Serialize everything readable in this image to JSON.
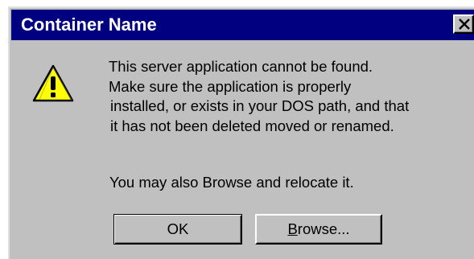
{
  "dialog": {
    "title": "Container Name",
    "close_icon": "close-x-icon",
    "icon": "warning-icon",
    "colors": {
      "titlebar": "#000080",
      "face": "#c0c0c0",
      "warning_fill": "#ffff00"
    },
    "message_lines": [
      "This server application cannot be found.",
      "Make sure the application is properly",
      "installed, or exists in your DOS path, and that",
      "it has not been deleted moved or renamed."
    ],
    "browse_note": "You may also Browse and relocate it."
  },
  "buttons": {
    "ok_label": "OK",
    "browse_accel": "B",
    "browse_rest": "rowse..."
  }
}
